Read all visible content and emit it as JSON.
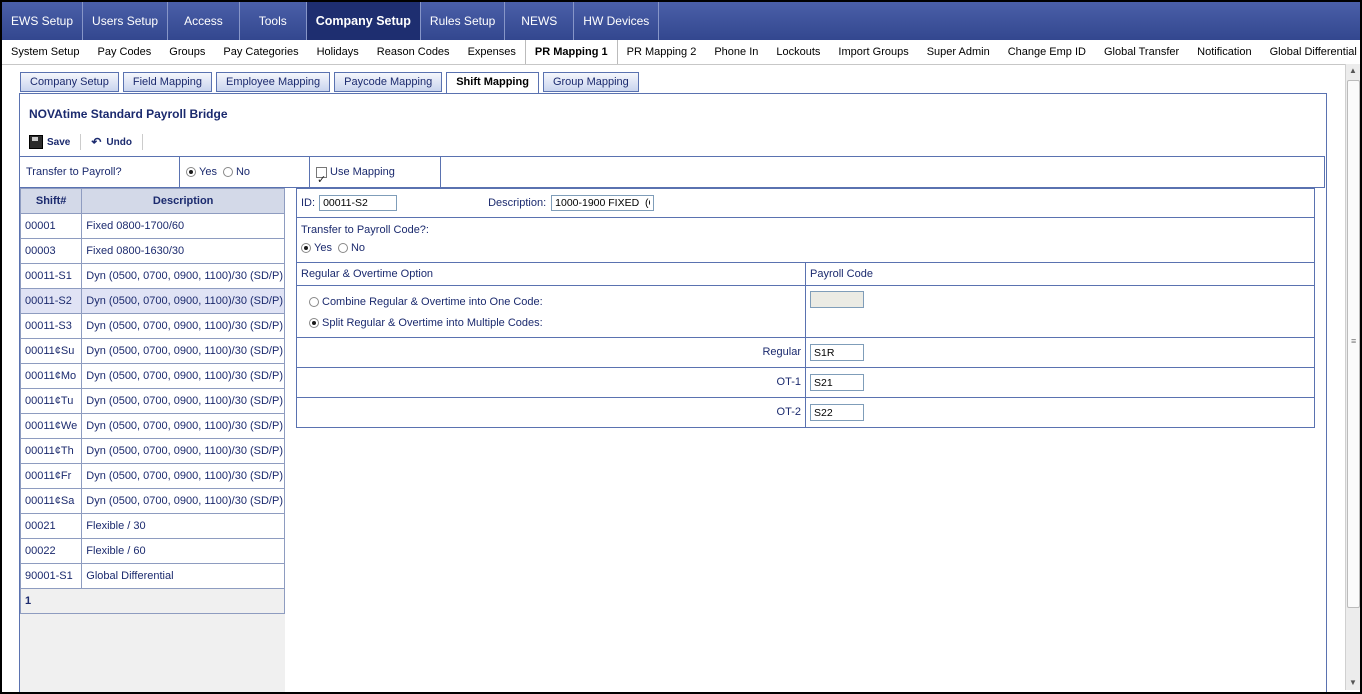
{
  "top_nav": [
    "EWS Setup",
    "Users Setup",
    "Access",
    "Tools",
    "Company Setup",
    "Rules Setup",
    "NEWS",
    "HW Devices"
  ],
  "sub_nav": [
    "System Setup",
    "Pay Codes",
    "Groups",
    "Pay Categories",
    "Holidays",
    "Reason Codes",
    "Expenses",
    "PR Mapping 1",
    "PR Mapping 2",
    "Phone In",
    "Lockouts",
    "Import Groups",
    "Super Admin",
    "Change Emp ID",
    "Global Transfer",
    "Notification",
    "Global Differential"
  ],
  "tabs": [
    "Company Setup",
    "Field Mapping",
    "Employee Mapping",
    "Paycode Mapping",
    "Shift Mapping",
    "Group Mapping"
  ],
  "title": "NOVAtime Standard Payroll Bridge",
  "toolbar": {
    "save": "Save",
    "undo": "Undo"
  },
  "transfer": {
    "label": "Transfer to Payroll?",
    "yes": "Yes",
    "no": "No",
    "use_mapping": "Use Mapping"
  },
  "grid": {
    "headers": [
      "Shift#",
      "Description"
    ],
    "rows": [
      [
        "00001",
        "Fixed 0800-1700/60"
      ],
      [
        "00003",
        "Fixed 0800-1630/30"
      ],
      [
        "00011-S1",
        "Dyn (0500, 0700, 0900, 1100)/30 (SD/P)"
      ],
      [
        "00011-S2",
        "Dyn (0500, 0700, 0900, 1100)/30 (SD/P)"
      ],
      [
        "00011-S3",
        "Dyn (0500, 0700, 0900, 1100)/30 (SD/P)"
      ],
      [
        "00011¢Su",
        "Dyn (0500, 0700, 0900, 1100)/30 (SD/P)"
      ],
      [
        "00011¢Mo",
        "Dyn (0500, 0700, 0900, 1100)/30 (SD/P)"
      ],
      [
        "00011¢Tu",
        "Dyn (0500, 0700, 0900, 1100)/30 (SD/P)"
      ],
      [
        "00011¢We",
        "Dyn (0500, 0700, 0900, 1100)/30 (SD/P)"
      ],
      [
        "00011¢Th",
        "Dyn (0500, 0700, 0900, 1100)/30 (SD/P)"
      ],
      [
        "00011¢Fr",
        "Dyn (0500, 0700, 0900, 1100)/30 (SD/P)"
      ],
      [
        "00011¢Sa",
        "Dyn (0500, 0700, 0900, 1100)/30 (SD/P)"
      ],
      [
        "00021",
        "Flexible / 30"
      ],
      [
        "00022",
        "Flexible / 60"
      ],
      [
        "90001-S1",
        "Global Differential"
      ]
    ],
    "page": "1"
  },
  "detail": {
    "id_label": "ID:",
    "id_value": "00011-S2",
    "desc_label": "Description:",
    "desc_value": "1000-1900 FIXED  (O",
    "transfer_code_label": "Transfer to Payroll Code?:",
    "yes": "Yes",
    "no": "No",
    "option_header": "Regular & Overtime Option",
    "payroll_code_header": "Payroll Code",
    "combine_label": "Combine Regular & Overtime into One Code:",
    "split_label": "Split Regular & Overtime into Multiple Codes:",
    "codes": [
      {
        "label": "Regular",
        "value": "S1R"
      },
      {
        "label": "OT-1",
        "value": "S21"
      },
      {
        "label": "OT-2",
        "value": "S22"
      }
    ]
  }
}
